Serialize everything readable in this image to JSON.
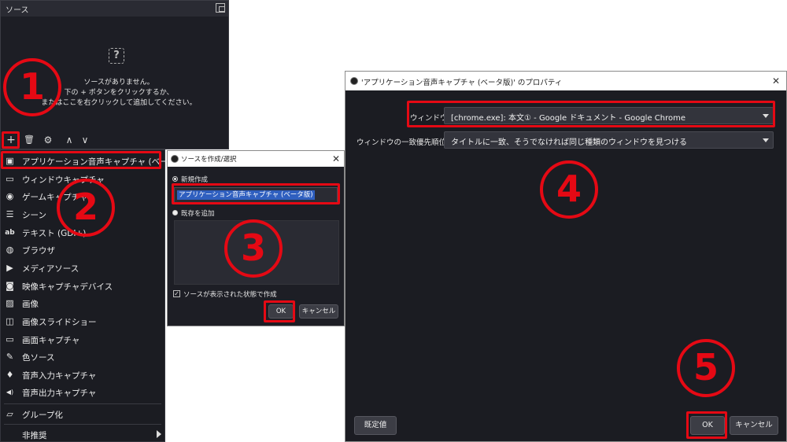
{
  "sources_panel": {
    "title": "ソース",
    "empty_line1": "ソースがありません。",
    "empty_line2": "下の + ボタンをクリックするか、",
    "empty_line3": "またはここを右クリックして追加してください。"
  },
  "toolbar": {
    "add": "+",
    "remove": "🗑",
    "settings": "⚙",
    "up": "∧",
    "down": "∨"
  },
  "menu": {
    "items": [
      {
        "label": "アプリケーション音声キャプチャ (ベータ版)",
        "icon": "▣"
      },
      {
        "label": "ウィンドウキャプチャ",
        "icon": "▭"
      },
      {
        "label": "ゲームキャプチャ",
        "icon": "◉"
      },
      {
        "label": "シーン",
        "icon": "☰"
      },
      {
        "label": "テキスト (GDI+)",
        "icon": "ab"
      },
      {
        "label": "ブラウザ",
        "icon": "◍"
      },
      {
        "label": "メディアソース",
        "icon": "▶"
      },
      {
        "label": "映像キャプチャデバイス",
        "icon": "◙"
      },
      {
        "label": "画像",
        "icon": "▨"
      },
      {
        "label": "画像スライドショー",
        "icon": "◫"
      },
      {
        "label": "画面キャプチャ",
        "icon": "▭"
      },
      {
        "label": "色ソース",
        "icon": "✎"
      },
      {
        "label": "音声入力キャプチャ",
        "icon": "♦"
      },
      {
        "label": "音声出力キャプチャ",
        "icon": "◀)"
      },
      {
        "label": "グループ化",
        "icon": "▱"
      },
      {
        "label": "非推奨",
        "icon": ""
      }
    ]
  },
  "create_dialog": {
    "title": "ソースを作成/選択",
    "close": "✕",
    "new_label": "新規作成",
    "name_value": "アプリケーション音声キャプチャ (ベータ版)",
    "existing_label": "既存を追加",
    "visible_label": "ソースが表示された状態で作成",
    "check": "✓",
    "ok": "OK",
    "cancel": "キャンセル"
  },
  "props_dialog": {
    "title": "'アプリケーション音声キャプチャ (ベータ版)' のプロパティ",
    "close": "✕",
    "window_label": "ウィンドウ",
    "window_value": "[chrome.exe]: 本文① - Google ドキュメント - Google Chrome",
    "priority_label": "ウィンドウの一致優先順位",
    "priority_value": "タイトルに一致、そうでなければ同じ種類のウィンドウを見つける",
    "defaults": "既定値",
    "ok": "OK",
    "cancel": "キャンセル"
  },
  "annotations": {
    "n1": "1",
    "n2": "2",
    "n3": "3",
    "n4": "4",
    "n5": "5",
    "color": "#e50914"
  }
}
